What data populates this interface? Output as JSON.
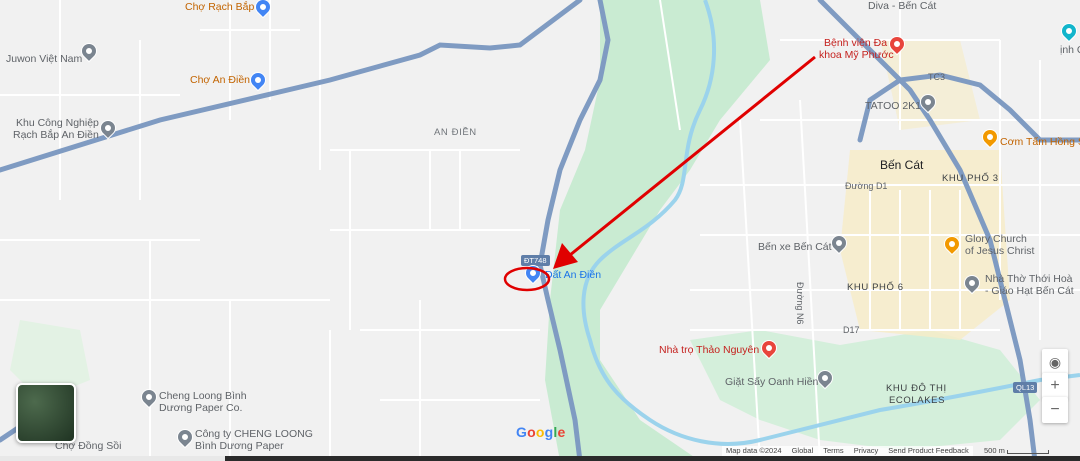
{
  "map": {
    "labels": {
      "cho_rach_bap": "Chợ Rạch Bắp",
      "juwon": "Juwon Việt Nam",
      "cho_an_dien": "Chợ An Điền",
      "kcn_line1": "Khu Công Nghiệp",
      "kcn_line2": "Rạch Bắp An Điền",
      "an_dien": "AN ĐIỀN",
      "dat_an_dien": "Đất An Điền",
      "road_dt748": "ĐT748",
      "benh_vien_line1": "Bệnh viện Đa",
      "benh_vien_line2": "khoa Mỹ Phước",
      "tatoo": "TATOO 2K1",
      "tc3": "TC3",
      "ben_cat": "Bến Cát",
      "com_tam": "Cơm Tấm Hồng S",
      "duong_d1": "Đường D1",
      "khu_pho_3": "KHU PHỐ 3",
      "ben_xe": "Bến xe Bến Cát",
      "glory_line1": "Glory Church",
      "glory_line2": "of Jesus Christ",
      "nha_tho_line1": "Nhà Thờ Thới Hoà",
      "nha_tho_line2": "- Giáo Hạt Bến Cát",
      "khu_pho_6": "KHU PHỐ 6",
      "duong_n6": "Đường N6",
      "d17": "D17",
      "nha_tro": "Nhà trọ Thảo Nguyên",
      "giat_say": "Giặt Sấy Oanh Hiền",
      "ecolakes_line1": "KHU ĐÔ THỊ",
      "ecolakes_line2": "ECOLAKES",
      "ql13": "QL13",
      "cheng_loong_1_line1": "Cheng Loong Bình",
      "cheng_loong_1_line2": "Dương Paper Co.",
      "cheng_loong_2_line1": "Công ty CHENG LOONG",
      "cheng_loong_2_line2": "Bình Dương Paper",
      "cho_dong_soi": "Chợ Đồng Sồi",
      "diva": "Diva - Bến Cát",
      "rich_partial": "ịnh Ở"
    },
    "footer": {
      "map_data": "Map data ©2024",
      "global": "Global",
      "terms": "Terms",
      "privacy": "Privacy",
      "feedback": "Send Product Feedback",
      "scale": "500 m"
    },
    "google_logo": "Google",
    "controls": {
      "zoom_in": "+",
      "zoom_out": "−"
    },
    "colors": {
      "land": "#f1f1f1",
      "major_road": "#7f9bc2",
      "minor_road": "#ffffff",
      "green_area": "#c9ebd2",
      "river": "#9bd3ec",
      "urban": "#f7ecc7",
      "annotation_red": "#e00000"
    }
  }
}
